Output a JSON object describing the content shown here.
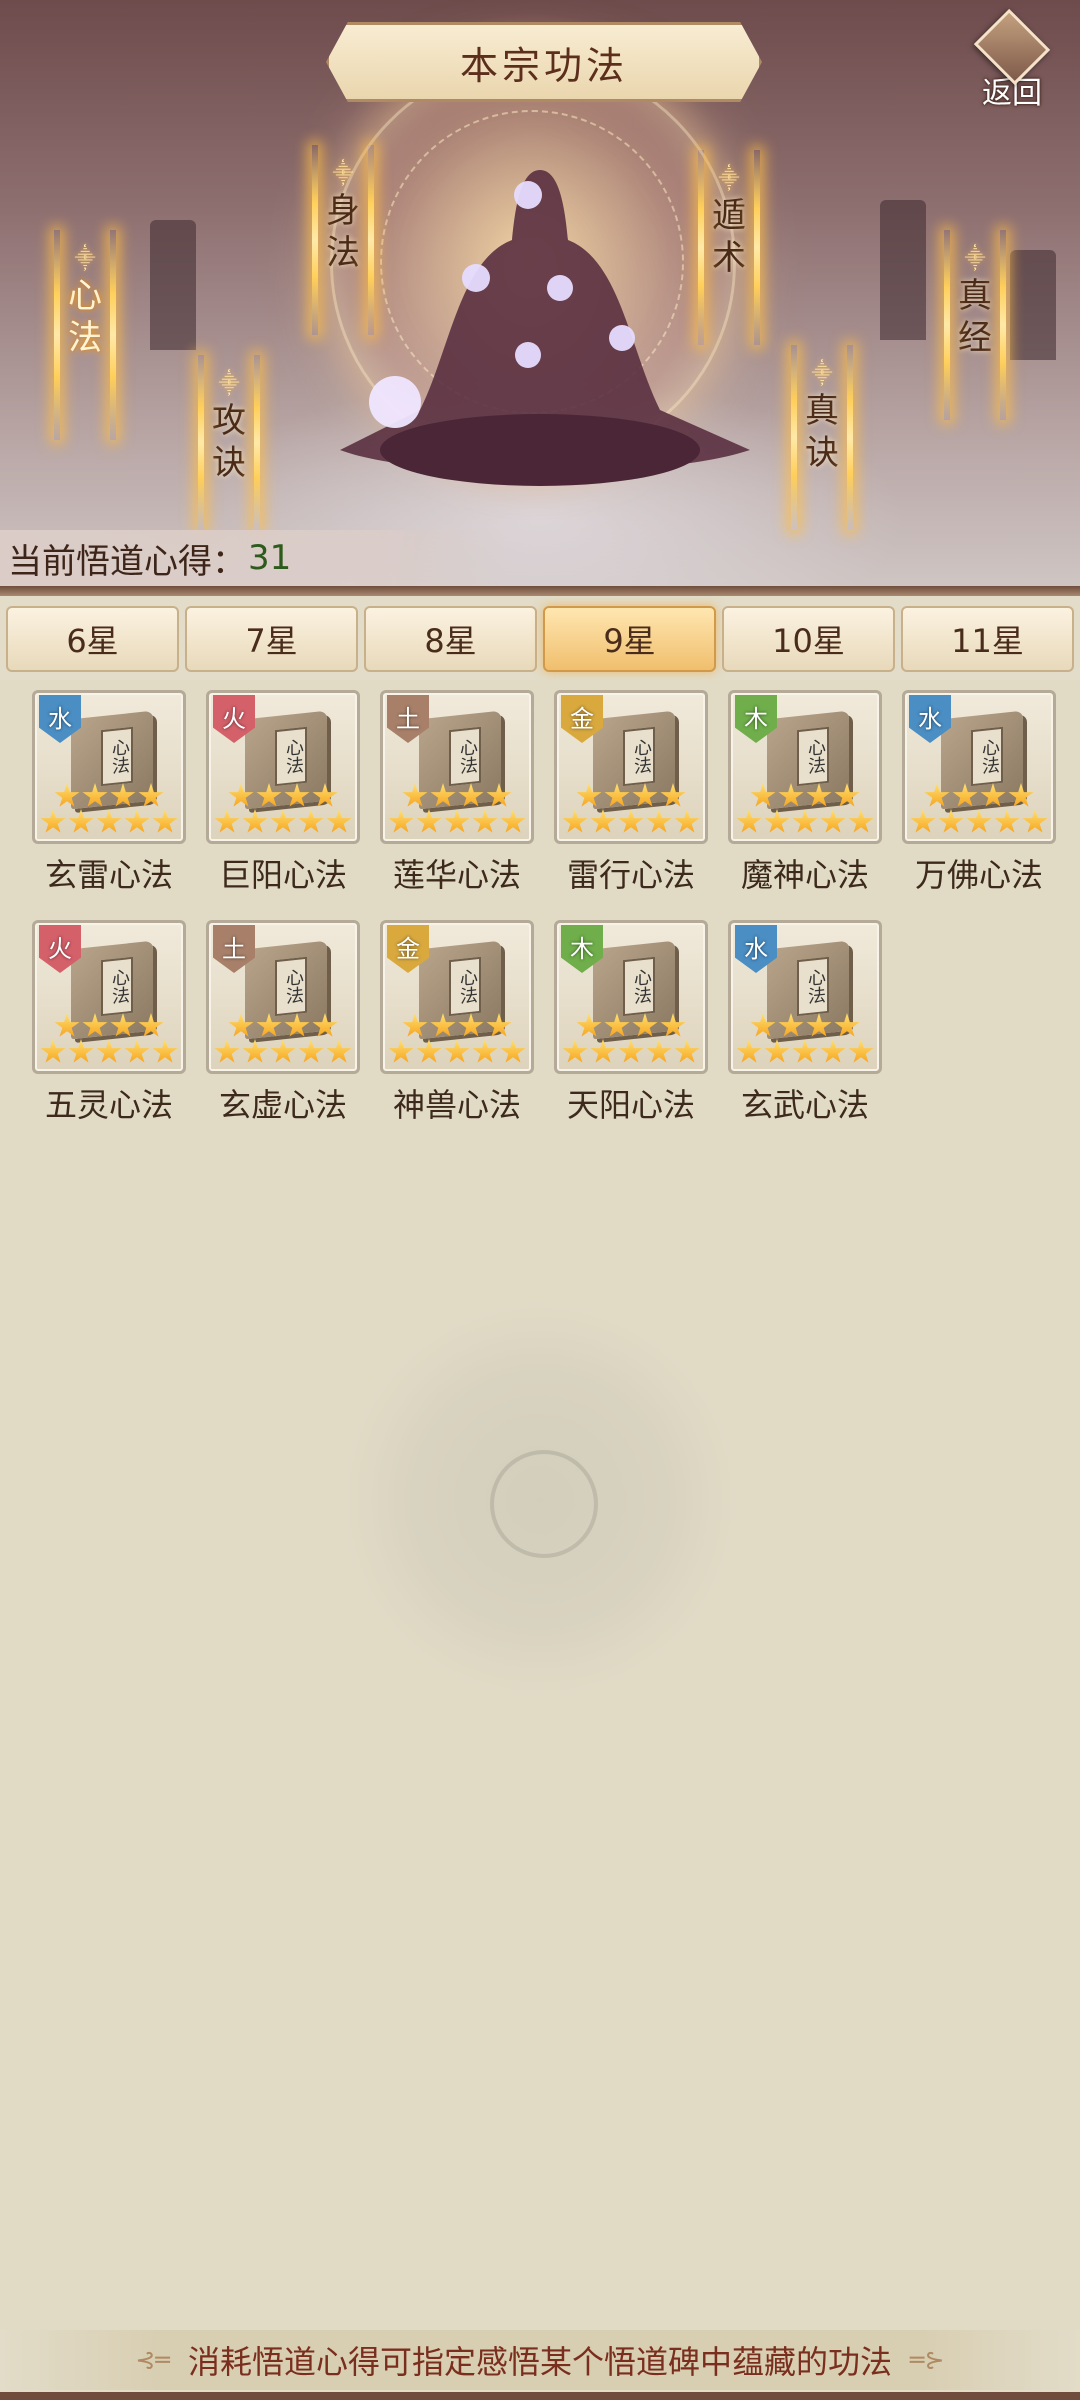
{
  "header": {
    "title": "本宗功法",
    "back_label": "返回"
  },
  "techniques": [
    {
      "id": "xinfa",
      "label": "心法",
      "active": true
    },
    {
      "id": "shenfa",
      "label": "身法",
      "active": false
    },
    {
      "id": "gongjue",
      "label": "攻诀",
      "active": false
    },
    {
      "id": "dunshu",
      "label": "遁术",
      "active": false
    },
    {
      "id": "zhenjue",
      "label": "真诀",
      "active": false
    },
    {
      "id": "zhenjing",
      "label": "真经",
      "active": false
    }
  ],
  "insight": {
    "label": "当前悟道心得：",
    "value": "31"
  },
  "tabs": [
    {
      "label": "6星",
      "active": false
    },
    {
      "label": "7星",
      "active": false
    },
    {
      "label": "8星",
      "active": false
    },
    {
      "label": "9星",
      "active": true
    },
    {
      "label": "10星",
      "active": false
    },
    {
      "label": "11星",
      "active": false
    }
  ],
  "items": [
    {
      "name": "玄雷心法",
      "element": "水",
      "element_color": "#4a8ec4",
      "stars": 9
    },
    {
      "name": "巨阳心法",
      "element": "火",
      "element_color": "#d4606a",
      "stars": 9
    },
    {
      "name": "莲华心法",
      "element": "土",
      "element_color": "#a8806a",
      "stars": 9
    },
    {
      "name": "雷行心法",
      "element": "金",
      "element_color": "#d9a93e",
      "stars": 9
    },
    {
      "name": "魔神心法",
      "element": "木",
      "element_color": "#6fae4a",
      "stars": 9
    },
    {
      "name": "万佛心法",
      "element": "水",
      "element_color": "#4a8ec4",
      "stars": 9
    },
    {
      "name": "五灵心法",
      "element": "火",
      "element_color": "#d4606a",
      "stars": 9
    },
    {
      "name": "玄虚心法",
      "element": "土",
      "element_color": "#a8806a",
      "stars": 9
    },
    {
      "name": "神兽心法",
      "element": "金",
      "element_color": "#d9a93e",
      "stars": 9
    },
    {
      "name": "天阳心法",
      "element": "木",
      "element_color": "#6fae4a",
      "stars": 9
    },
    {
      "name": "玄武心法",
      "element": "水",
      "element_color": "#4a8ec4",
      "stars": 9
    }
  ],
  "book_label": "心法",
  "footer": {
    "tip": "消耗悟道心得可指定感悟某个悟道碑中蕴藏的功法"
  }
}
